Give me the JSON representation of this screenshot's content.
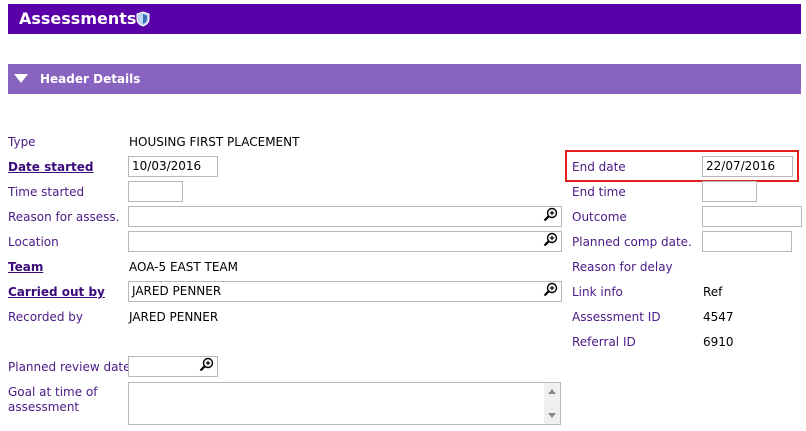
{
  "header": {
    "title": "Assessments",
    "shield_icon": "shield-icon"
  },
  "section": {
    "label": "Header Details",
    "toggle_icon": "triangle-down-icon"
  },
  "left": {
    "type_label": "Type",
    "type_value": "HOUSING FIRST PLACEMENT",
    "date_started_label": "Date started",
    "date_started_value": "10/03/2016",
    "time_started_label": "Time started",
    "time_started_value": "",
    "reason_label": "Reason for assess.",
    "reason_value": "",
    "location_label": "Location",
    "location_value": "",
    "team_label": "Team",
    "team_value": "AOA-5 EAST TEAM",
    "carried_out_by_label": "Carried out by",
    "carried_out_by_value": "JARED PENNER",
    "recorded_by_label": "Recorded by",
    "recorded_by_value": "JARED PENNER",
    "planned_review_label": "Planned review date",
    "planned_review_value": "",
    "goal_label_line1": "Goal at time of",
    "goal_label_line2": "assessment",
    "goal_value": ""
  },
  "right": {
    "end_date_label": "End date",
    "end_date_value": "22/07/2016",
    "end_time_label": "End time",
    "end_time_value": "",
    "outcome_label": "Outcome",
    "outcome_value": "",
    "planned_comp_label": "Planned comp date.",
    "planned_comp_value": "",
    "reason_delay_label": "Reason for delay",
    "link_info_label": "Link info",
    "link_info_value": "Ref",
    "assessment_id_label": "Assessment ID",
    "assessment_id_value": "4547",
    "referral_id_label": "Referral ID",
    "referral_id_value": "6910"
  },
  "icons": {
    "lookup": "magnifier-plus-icon"
  },
  "colors": {
    "header_bg": "#5a00a8",
    "section_bg": "#8863c0",
    "label": "#4b1a86",
    "highlight": "#e0201c"
  }
}
